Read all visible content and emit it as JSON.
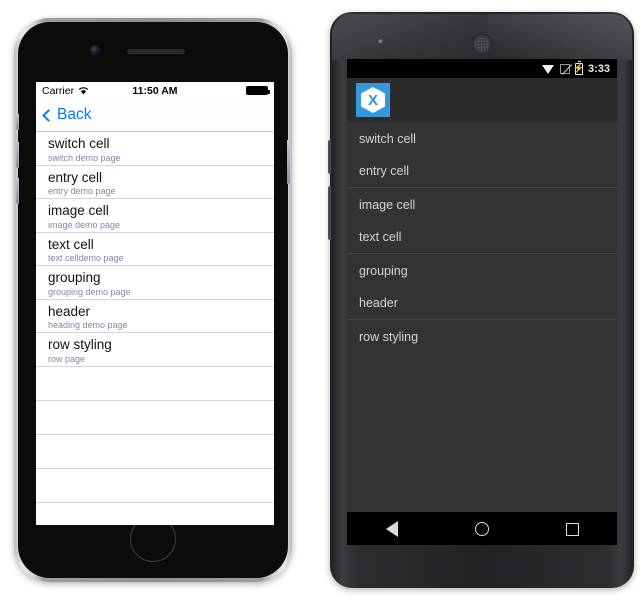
{
  "ios": {
    "status": {
      "carrier": "Carrier",
      "wifi_icon": "wifi-icon",
      "time": "11:50 AM",
      "battery_icon": "battery-full-icon"
    },
    "nav": {
      "back_label": "Back",
      "back_chevron_icon": "chevron-left-icon",
      "accent_color": "#007aff"
    },
    "cells": [
      {
        "title": "switch cell",
        "detail": "switch demo page"
      },
      {
        "title": "entry cell",
        "detail": "entry demo page"
      },
      {
        "title": "image cell",
        "detail": "image demo page"
      },
      {
        "title": "text cell",
        "detail": "text celldemo page"
      },
      {
        "title": "grouping",
        "detail": "grouping demo page"
      },
      {
        "title": "header",
        "detail": "heading demo page"
      },
      {
        "title": "row styling",
        "detail": "row page"
      }
    ],
    "empty_row_count": 4,
    "detail_color": "#7e88ad"
  },
  "android": {
    "status": {
      "wifi_icon": "wifi-icon",
      "signal_icon": "signal-off-icon",
      "battery_icon": "battery-charging-icon",
      "time": "3:33"
    },
    "action_bar": {
      "app_icon": "xamarin-logo-icon",
      "app_icon_glyph": "X",
      "accent_color": "#3498db"
    },
    "rows": [
      {
        "label": "switch cell",
        "group_end": false
      },
      {
        "label": "entry cell",
        "group_end": true
      },
      {
        "label": "image cell",
        "group_end": false
      },
      {
        "label": "text cell",
        "group_end": true
      },
      {
        "label": "grouping",
        "group_end": false
      },
      {
        "label": "header",
        "group_end": true
      },
      {
        "label": "row styling",
        "group_end": false
      }
    ],
    "navbar": {
      "back_icon": "nav-back-icon",
      "home_icon": "nav-home-icon",
      "recents_icon": "nav-recents-icon"
    },
    "list_bg": "#333333"
  }
}
